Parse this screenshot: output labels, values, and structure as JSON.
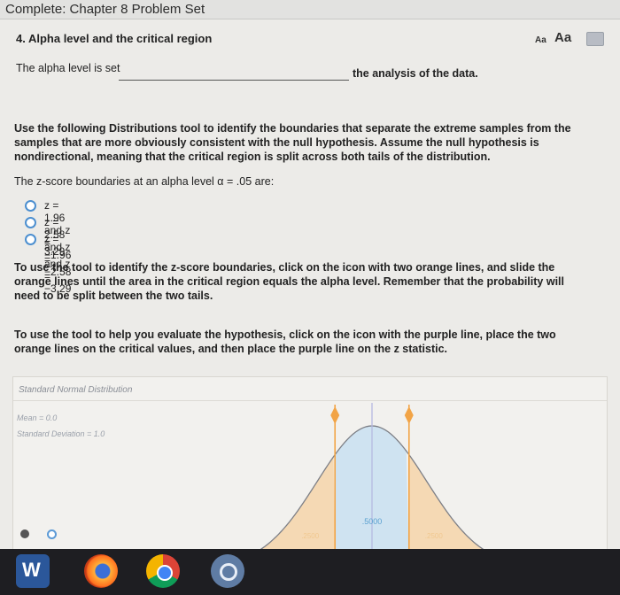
{
  "window": {
    "title": "Complete: Chapter 8 Problem Set"
  },
  "question": {
    "title": "4. Alpha level and the critical region",
    "text_size_small_label": "Aa",
    "text_size_large_label": "Aa",
    "blank_prefix": "The alpha level is set",
    "blank_value": "",
    "blank_suffix": "the analysis of the data.",
    "instructions": "Use the following Distributions tool to identify the boundaries that separate the extreme samples from the samples that are more obviously consistent with the null hypothesis. Assume the null hypothesis is nondirectional, meaning that the critical region is split across both tails of the distribution.",
    "zscore_question": "The z-score boundaries at an alpha level α = .05 are:",
    "options": [
      {
        "label": "z = 1.96 and z = −1.96"
      },
      {
        "label": "z = 2.58 and z = −2.58"
      },
      {
        "label": "z = 3.29 and z = −3.29"
      }
    ],
    "tool_hint_1": "To use the tool to identify the z-score boundaries, click on the icon with two orange lines, and slide the orange lines until the area in the critical region equals the alpha level. Remember that the probability will need to be split between the two tails.",
    "tool_hint_2": "To use the tool to help you evaluate the hypothesis, click on the icon with the purple line, place the two orange lines on the critical values, and then place the purple line on the z statistic."
  },
  "distribution_tool": {
    "title": "Standard Normal Distribution",
    "mean_label": "Mean = 0.0",
    "sd_label": "Standard Deviation = 1.0",
    "center_area_label": ".5000",
    "left_tail_label": ".2500",
    "right_tail_label": ".2500",
    "colors": {
      "curve": "#7d7f86",
      "tail_fill": "#f5d9b4",
      "center_fill": "#cfe3f1",
      "orange_line": "#f2a446",
      "handle": "#f2a446",
      "purple_line": "#b5b9e0"
    }
  },
  "chart_data": {
    "type": "area",
    "title": "Standard Normal Distribution",
    "mean": 0.0,
    "sd": 1.0,
    "critical_lines_z": [
      -0.674,
      0.674
    ],
    "purple_line_z": 0.0,
    "areas": [
      {
        "region": "left tail",
        "value": ".2500"
      },
      {
        "region": "center",
        "value": ".5000"
      },
      {
        "region": "right tail",
        "value": ".2500"
      }
    ]
  },
  "taskbar": {
    "apps": [
      {
        "name": "word-icon",
        "glyph": "W"
      },
      {
        "name": "firefox-icon"
      },
      {
        "name": "chrome-icon"
      },
      {
        "name": "app-icon"
      }
    ]
  }
}
